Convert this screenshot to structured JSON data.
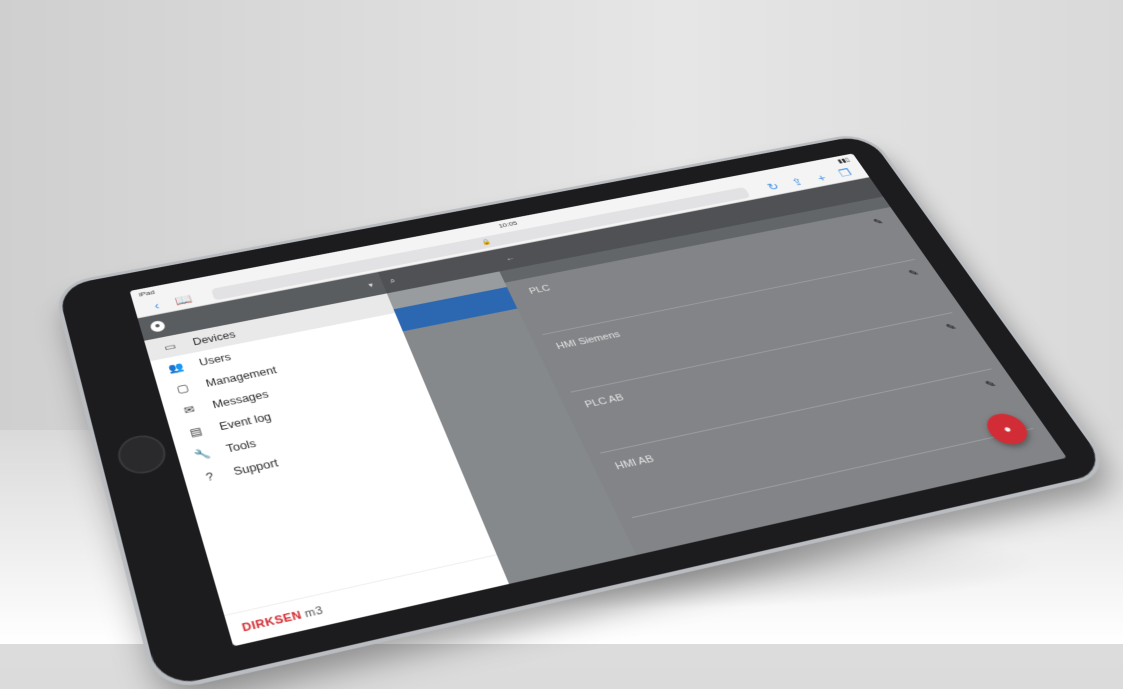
{
  "status": {
    "left": "iPad",
    "time": "10:05",
    "right": ""
  },
  "safari": {
    "url": "",
    "back_icon": "chevron-left-icon",
    "bookmarks_icon": "book-icon"
  },
  "user": {
    "line1": "",
    "line2": ""
  },
  "sidebar": {
    "items": [
      {
        "label": "Devices",
        "icon": "devices-icon",
        "glyph": "▭",
        "active": true
      },
      {
        "label": "Users",
        "icon": "users-icon",
        "glyph": "👥",
        "active": false
      },
      {
        "label": "Management",
        "icon": "management-icon",
        "glyph": "▢",
        "active": false
      },
      {
        "label": "Messages",
        "icon": "messages-icon",
        "glyph": "✉",
        "active": false
      },
      {
        "label": "Event log",
        "icon": "event-log-icon",
        "glyph": "▤",
        "active": false
      },
      {
        "label": "Tools",
        "icon": "tools-icon",
        "glyph": "🔧",
        "active": false
      },
      {
        "label": "Support",
        "icon": "support-icon",
        "glyph": "?",
        "active": false
      }
    ]
  },
  "footer": {
    "brand": "DIRKSEN",
    "brand_suffix": "m3",
    "powered_by": ""
  },
  "main": {
    "title": "",
    "tabs": [
      "",
      "",
      "",
      "",
      ""
    ],
    "devices": [
      {
        "name": "PLC",
        "sub": "",
        "col1": "",
        "col2": "",
        "col3": ""
      },
      {
        "name": "HMI Siemens",
        "sub": "",
        "col1": "",
        "col2": "",
        "col3": ""
      },
      {
        "name": "PLC AB",
        "sub": "",
        "col1": "",
        "col2": "",
        "col3": ""
      },
      {
        "name": "HMI AB",
        "sub": "",
        "col1": "",
        "col2": "",
        "col3": ""
      }
    ]
  },
  "colors": {
    "accent": "#e0303a",
    "selection": "#2f6fbd",
    "brand": "#d2262c"
  }
}
